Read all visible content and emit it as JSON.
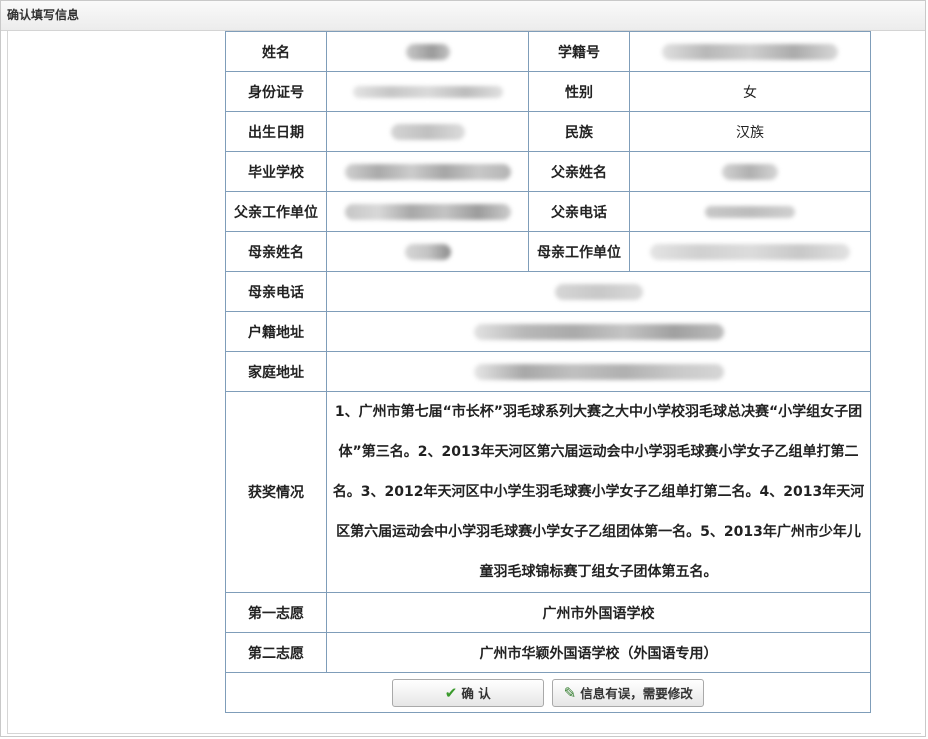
{
  "window": {
    "title": "确认填写信息"
  },
  "form": {
    "name_label": "姓名",
    "student_id_label": "学籍号",
    "id_card_label": "身份证号",
    "gender_label": "性别",
    "gender_value": "女",
    "birth_label": "出生日期",
    "ethnicity_label": "民族",
    "ethnicity_value": "汉族",
    "school_label": "毕业学校",
    "father_name_label": "父亲姓名",
    "father_work_label": "父亲工作单位",
    "father_phone_label": "父亲电话",
    "mother_name_label": "母亲姓名",
    "mother_work_label": "母亲工作单位",
    "mother_phone_label": "母亲电话",
    "household_label": "户籍地址",
    "home_label": "家庭地址",
    "awards_label": "获奖情况",
    "awards_value": "1、广州市第七届“市长杯”羽毛球系列大赛之大中小学校羽毛球总决赛“小学组女子团体”第三名。2、2013年天河区第六届运动会中小学羽毛球赛小学女子乙组单打第二名。3、2012年天河区中小学生羽毛球赛小学女子乙组单打第二名。4、2013年天河区第六届运动会中小学羽毛球赛小学女子乙组团体第一名。5、2013年广州市少年儿童羽毛球锦标赛丁组女子团体第五名。",
    "first_choice_label": "第一志愿",
    "first_choice_value": "广州市外国语学校",
    "second_choice_label": "第二志愿",
    "second_choice_value": "广州市华颖外国语学校（外国语专用）"
  },
  "buttons": {
    "confirm": "确 认",
    "edit": "信息有误，需要修改"
  },
  "icons": {
    "confirm": "check-icon",
    "edit": "pencil-icon"
  },
  "colors": {
    "border": "#7f9db9",
    "check": "#3a9a2c"
  }
}
